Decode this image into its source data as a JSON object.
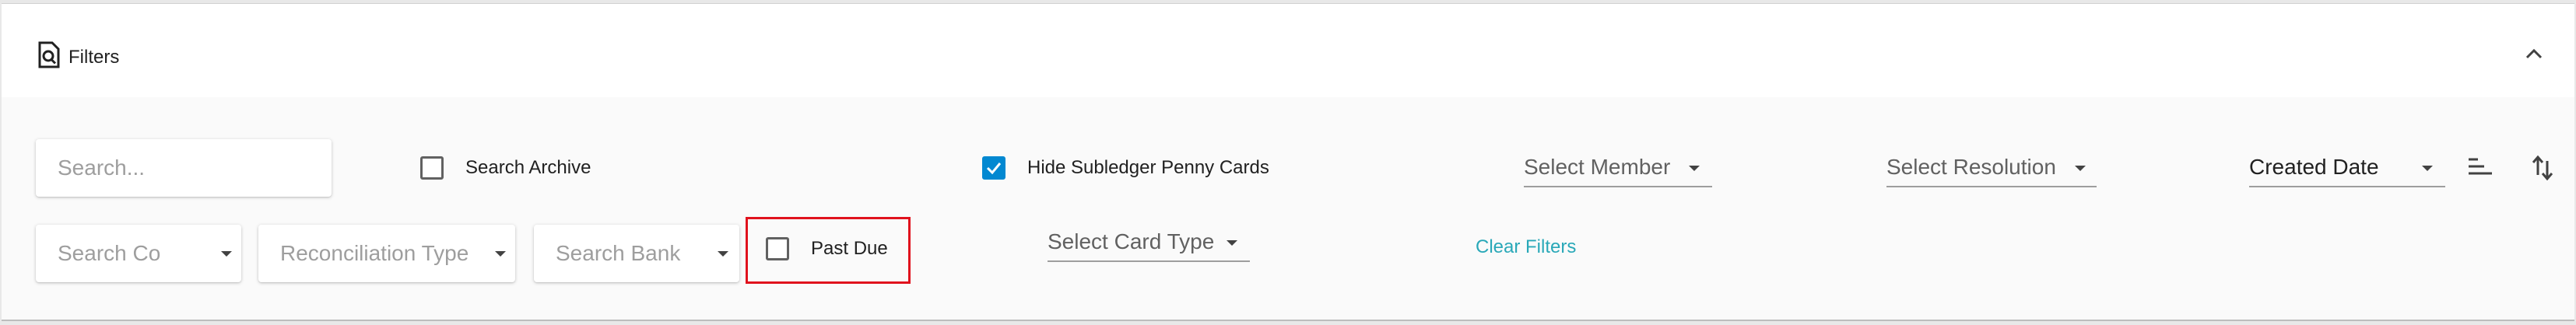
{
  "header": {
    "title": "Filters",
    "filters_icon": "document-search-icon",
    "collapse_icon": "chevron-up-icon"
  },
  "row1": {
    "search": {
      "value": "",
      "placeholder": "Search..."
    },
    "search_archive": {
      "label": "Search Archive",
      "checked": false
    },
    "hide_subledger": {
      "label": "Hide Subledger Penny Cards",
      "checked": true
    },
    "select_member": {
      "label": "Select Member"
    },
    "select_resolution": {
      "label": "Select Resolution"
    },
    "sort_field": {
      "value": "Created Date"
    },
    "sort_order_icon": "sort-lines-icon",
    "sort_direction_icon": "swap-vertical-icon"
  },
  "row2": {
    "search_co": {
      "placeholder": "Search Co"
    },
    "reconciliation_type": {
      "placeholder": "Reconciliation Type"
    },
    "search_bank": {
      "placeholder": "Search Bank"
    },
    "past_due": {
      "label": "Past Due",
      "checked": false
    },
    "select_card_type": {
      "label": "Select Card Type"
    },
    "clear_filters": {
      "label": "Clear Filters"
    }
  },
  "colors": {
    "accent_checkbox": "#0288d1",
    "clear_filters_link": "#29a8b8",
    "highlight_border": "#e0121d"
  }
}
